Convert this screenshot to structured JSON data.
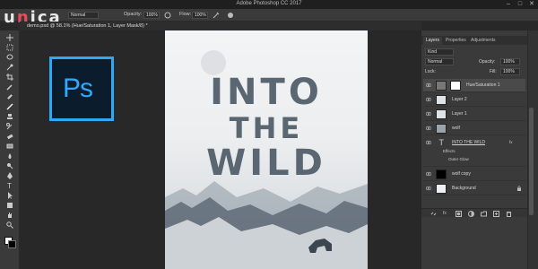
{
  "app": {
    "window_title": "Adobe Photoshop CC 2017",
    "watermark_logo": "unica"
  },
  "options_bar": {
    "mode_value": "Normal",
    "opacity_label": "Opacity:",
    "opacity_value": "100%",
    "flow_label": "Flow:",
    "flow_value": "100%"
  },
  "document": {
    "tab_label": "demo.psd @ 58.1% (Hue/Saturation 1, Layer Mask/8) *"
  },
  "canvas": {
    "ps_badge": "Ps",
    "poster_lines": [
      "INTO",
      "THE",
      "WILD"
    ]
  },
  "layers_panel": {
    "tabs": [
      "Layers",
      "Properties",
      "Adjustments"
    ],
    "kind_label": "Kind",
    "blend_mode": "Normal",
    "opacity_label": "Opacity:",
    "opacity_value": "100%",
    "lock_label": "Lock:",
    "fill_label": "Fill:",
    "fill_value": "100%",
    "layers": [
      {
        "name": "Hue/Saturation 1"
      },
      {
        "name": "Layer 2"
      },
      {
        "name": "Layer 1"
      },
      {
        "name": "wolf"
      },
      {
        "name": "INTO THE WILD"
      },
      {
        "name": "wolf copy"
      },
      {
        "name": "Background"
      }
    ],
    "effects_label": "Effects",
    "outer_glow_label": "Outer Glow",
    "fx_label": "fx"
  },
  "colors": {
    "accent_ps": "#31a8ff",
    "foreground": "#ffffff",
    "background": "#000000"
  }
}
